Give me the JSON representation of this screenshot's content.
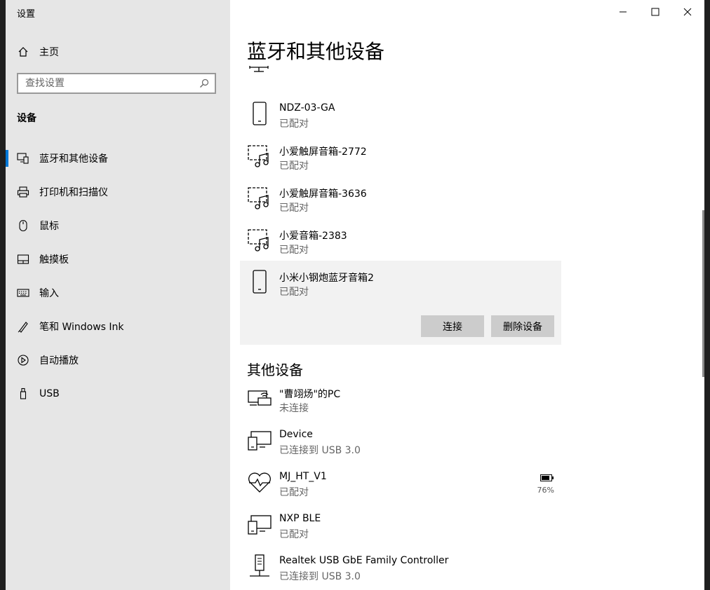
{
  "window": {
    "title": "设置"
  },
  "sidebar": {
    "home_label": "主页",
    "search_placeholder": "查找设置",
    "section_title": "设备",
    "items": [
      {
        "label": "蓝牙和其他设备",
        "icon": "bluetooth-devices-icon",
        "active": true
      },
      {
        "label": "打印机和扫描仪",
        "icon": "printer-icon"
      },
      {
        "label": "鼠标",
        "icon": "mouse-icon"
      },
      {
        "label": "触摸板",
        "icon": "touchpad-icon"
      },
      {
        "label": "输入",
        "icon": "keyboard-icon"
      },
      {
        "label": "笔和 Windows Ink",
        "icon": "pen-icon"
      },
      {
        "label": "自动播放",
        "icon": "autoplay-icon"
      },
      {
        "label": "USB",
        "icon": "usb-icon"
      }
    ]
  },
  "main": {
    "title": "蓝牙和其他设备",
    "devices": [
      {
        "name": "NDZ-03-GA",
        "status": "已配对",
        "icon": "phone-icon"
      },
      {
        "name": "小爱触屏音箱-2772",
        "status": "已配对",
        "icon": "audio-display-icon"
      },
      {
        "name": "小爱触屏音箱-3636",
        "status": "已配对",
        "icon": "audio-display-icon"
      },
      {
        "name": "小爱音箱-2383",
        "status": "已配对",
        "icon": "audio-display-icon"
      },
      {
        "name": "小米小钢炮蓝牙音箱2",
        "status": "已配对",
        "icon": "phone-icon",
        "selected": true
      }
    ],
    "selected_actions": {
      "connect_label": "连接",
      "remove_label": "删除设备"
    },
    "other_devices_title": "其他设备",
    "other_devices": [
      {
        "name": "\"曹翊炀\"的PC",
        "status": "未连接",
        "icon": "wireless-pc-icon"
      },
      {
        "name": "Device",
        "status": "已连接到 USB 3.0",
        "icon": "generic-device-icon"
      },
      {
        "name": "MJ_HT_V1",
        "status": "已配对",
        "icon": "heart-rate-icon",
        "battery": "76%"
      },
      {
        "name": "NXP BLE",
        "status": "已配对",
        "icon": "generic-device-icon"
      },
      {
        "name": "Realtek USB GbE Family Controller",
        "status": "已连接到 USB 3.0",
        "icon": "network-adapter-icon"
      }
    ]
  }
}
